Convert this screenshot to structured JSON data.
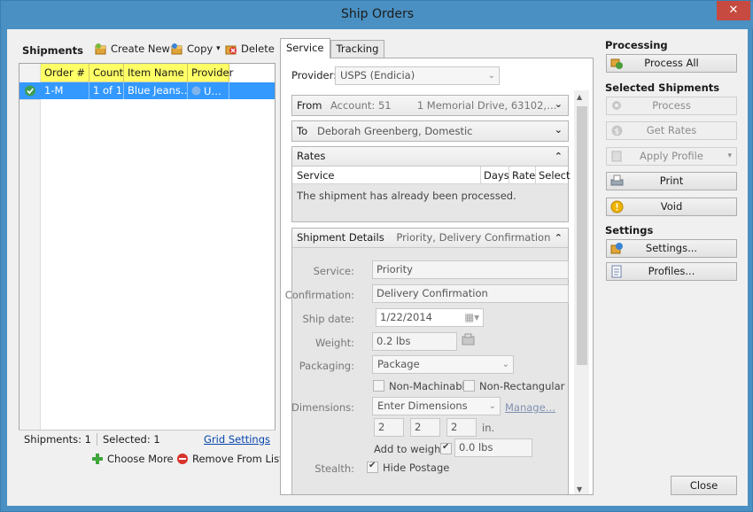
{
  "window": {
    "title": "Ship Orders",
    "close_glyph": "✕"
  },
  "left": {
    "heading": "Shipments",
    "toolbar": {
      "create_new": "Create New",
      "copy": "Copy",
      "copy_arrow": "▾",
      "delete": "Delete"
    },
    "columns": [
      "Order #",
      "Count",
      "Item Name",
      "Provider"
    ],
    "rows": [
      {
        "order": "1-M",
        "count": "1 of 1",
        "item": "Blue Jeans…",
        "provider": "U…"
      }
    ],
    "status": {
      "shipments": "Shipments: 1",
      "selected": "Selected: 1",
      "grid_settings": "Grid Settings"
    },
    "choose_more": "Choose More",
    "remove": "Remove From List"
  },
  "center": {
    "tabs": [
      "Service",
      "Tracking"
    ],
    "provider_label": "Provider:",
    "provider_value": "USPS (Endicia)",
    "from": {
      "label": "From",
      "value": "Account: 51        1 Memorial Drive, 63102,…"
    },
    "to": {
      "label": "To",
      "value": "Deborah Greenberg, Domestic"
    },
    "rates": {
      "label": "Rates",
      "columns": [
        "Service",
        "Days",
        "Rate",
        "Select"
      ],
      "message": "The shipment has already been processed."
    },
    "details": {
      "label": "Shipment Details",
      "summary": "Priority, Delivery Confirmation",
      "service_label": "Service:",
      "service_value": "Priority",
      "confirmation_label": "Confirmation:",
      "confirmation_value": "Delivery Confirmation",
      "shipdate_label": "Ship date:",
      "shipdate_value": "1/22/2014",
      "weight_label": "Weight:",
      "weight_value": "0.2 lbs",
      "packaging_label": "Packaging:",
      "packaging_value": "Package",
      "non_machinable": "Non-Machinable",
      "non_rectangular": "Non-Rectangular",
      "dimensions_label": "Dimensions:",
      "dimensions_value": "Enter Dimensions",
      "manage": "Manage…",
      "dim_l": "2",
      "dim_w": "2",
      "dim_h": "2",
      "dim_unit": "in.",
      "add_to_weight": "Add to weight",
      "add_weight_value": "0.0 lbs",
      "stealth_label": "Stealth:",
      "hide_postage": "Hide Postage"
    }
  },
  "right": {
    "processing": "Processing",
    "process_all": "Process All",
    "selected_shipments": "Selected Shipments",
    "process": "Process",
    "get_rates": "Get Rates",
    "apply_profile": "Apply Profile",
    "apply_profile_arrow": "▾",
    "print": "Print",
    "void": "Void",
    "settings_heading": "Settings",
    "settings_btn": "Settings...",
    "profiles_btn": "Profiles...",
    "close": "Close"
  },
  "colors": {
    "accent": "#4a90c2",
    "selection": "#3399ff",
    "header_yellow": "#ffff66",
    "close_red": "#c64a3f"
  }
}
